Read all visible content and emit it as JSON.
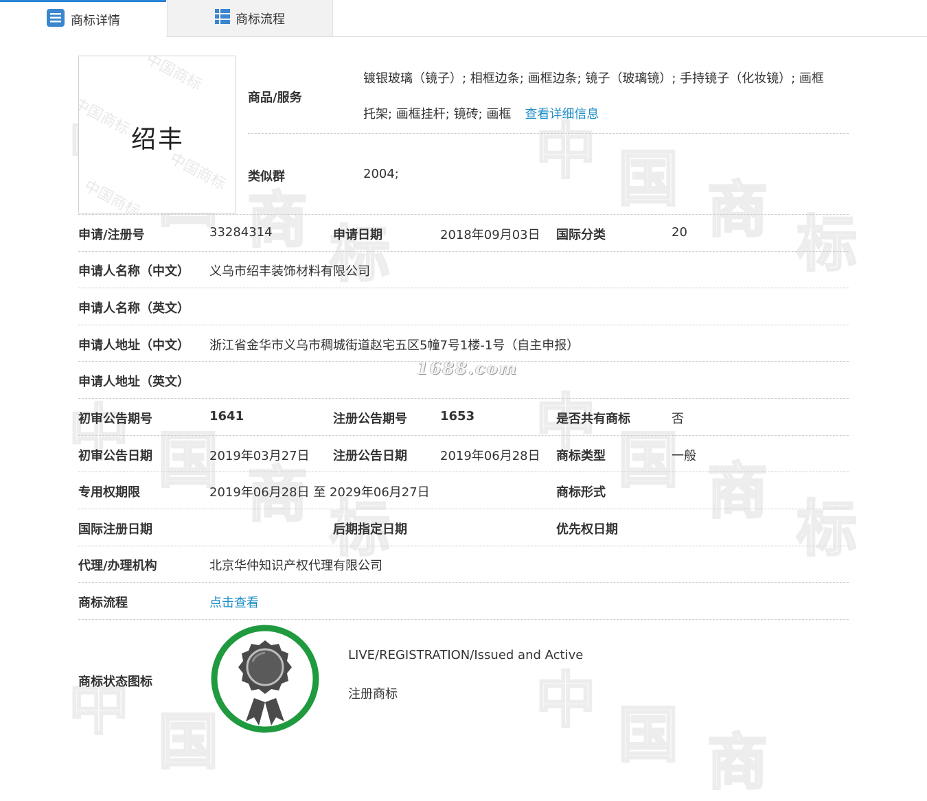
{
  "tabs": [
    {
      "label": "商标详情",
      "icon": "list-detail-icon",
      "active": true
    },
    {
      "label": "商标流程",
      "icon": "table-grid-icon",
      "active": false
    }
  ],
  "trademark": {
    "logo_text": "绍丰",
    "goods_label": "商品/服务",
    "goods_line1": "镀银玻璃（镜子）; 相框边条; 画框边条; 镜子（玻璃镜）; 手持镜子（化妆镜）; 画框",
    "goods_line2": "托架; 画框挂杆; 镜砖; 画框",
    "goods_link": "查看详细信息",
    "similar_group_label": "类似群",
    "similar_group": "2004;"
  },
  "fields": {
    "reg_no_label": "申请/注册号",
    "reg_no": "33284314",
    "apply_date_label": "申请日期",
    "apply_date": "2018年09月03日",
    "intl_class_label": "国际分类",
    "intl_class": "20",
    "applicant_cn_label": "申请人名称（中文）",
    "applicant_cn": "义乌市绍丰装饰材料有限公司",
    "applicant_en_label": "申请人名称（英文）",
    "applicant_en": "",
    "address_cn_label": "申请人地址（中文）",
    "address_cn": "浙江省金华市义乌市稠城街道赵宅五区5幢7号1楼-1号（自主申报）",
    "address_en_label": "申请人地址（英文）",
    "address_en": "",
    "prelim_issue_label": "初审公告期号",
    "prelim_issue": "1641",
    "reg_issue_label": "注册公告期号",
    "reg_issue": "1653",
    "shared_label": "是否共有商标",
    "shared": "否",
    "prelim_date_label": "初审公告日期",
    "prelim_date": "2019年03月27日",
    "reg_date_label": "注册公告日期",
    "reg_date": "2019年06月28日",
    "tm_type_label": "商标类型",
    "tm_type": "一般",
    "exclusive_label": "专用权期限",
    "exclusive": "2019年06月28日 至 2029年06月27日",
    "tm_form_label": "商标形式",
    "tm_form": "",
    "intl_reg_date_label": "国际注册日期",
    "intl_reg_date": "",
    "later_date_label": "后期指定日期",
    "later_date": "",
    "priority_date_label": "优先权日期",
    "priority_date": "",
    "agent_label": "代理/办理机构",
    "agent": "北京华仲知识产权代理有限公司",
    "process_label": "商标流程",
    "process_link": "点击查看",
    "status_icon_label": "商标状态图标",
    "status_en": "LIVE/REGISTRATION/Issued and Active",
    "status_cn": "注册商标"
  },
  "watermark": {
    "site": "1688.com",
    "logo_watermark": "中国商标"
  },
  "colors": {
    "tab_accent": "#2a83d4",
    "link": "#1e8ec8",
    "badge_ring": "#1f9a3e",
    "badge_medal": "#4a4a4a"
  }
}
